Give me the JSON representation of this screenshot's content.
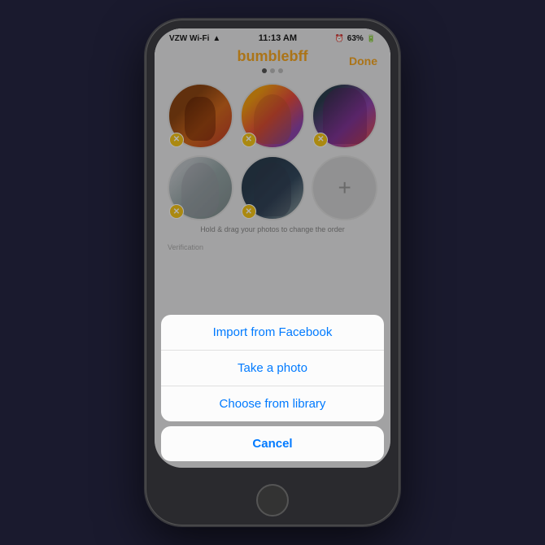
{
  "app": {
    "name_part1": "bumble",
    "name_part2": "bff",
    "done_label": "Done"
  },
  "status_bar": {
    "carrier": "VZW Wi-Fi",
    "time": "11:13 AM",
    "battery": "63%"
  },
  "photo_grid": {
    "hint": "Hold & drag your photos to change the order",
    "add_icon": "+"
  },
  "verification": {
    "label": "Verification"
  },
  "action_sheet": {
    "import_label": "Import from Facebook",
    "take_photo_label": "Take a photo",
    "choose_library_label": "Choose from library",
    "cancel_label": "Cancel"
  }
}
